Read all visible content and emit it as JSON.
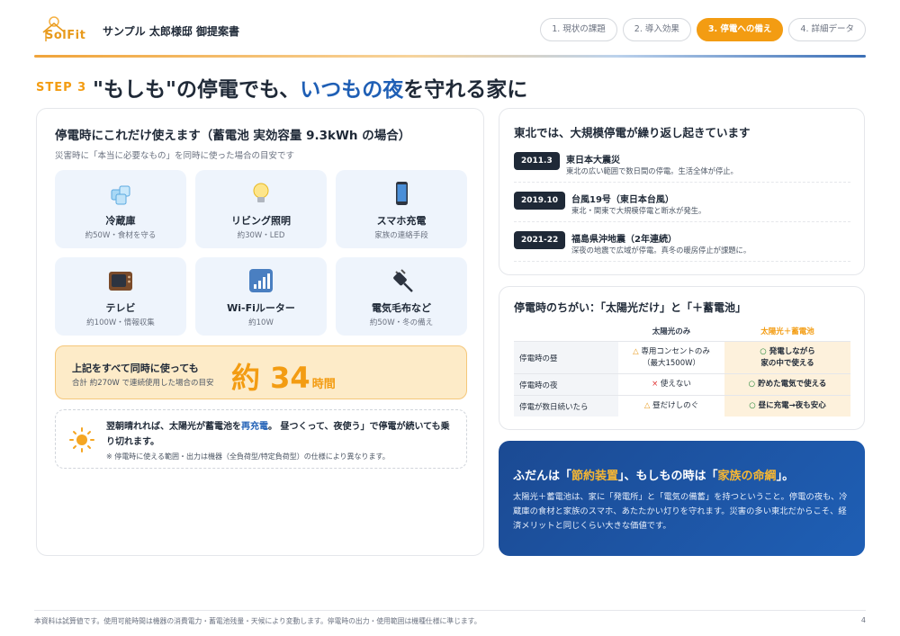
{
  "header": {
    "logo_text": "SolFit",
    "doc_title": "サンプル 太郎様邸 御提案書",
    "nav": [
      {
        "label": "1. 現状の課題",
        "active": false
      },
      {
        "label": "2. 導入効果",
        "active": false
      },
      {
        "label": "3. 停電への備え",
        "active": true
      },
      {
        "label": "4. 詳細データ",
        "active": false
      }
    ]
  },
  "headline": {
    "step": "STEP 3",
    "part1": "\"もしも\"の停電でも、",
    "highlight": "いつもの夜",
    "part2": "を守れる家に"
  },
  "left": {
    "title": "停電時にこれだけ使えます（蓄電池 実効容量 9.3kWh の場合）",
    "subtitle": "災害時に「本当に必要なもの」を同時に使った場合の目安です",
    "tiles": [
      {
        "icon": "ice-cube-icon",
        "label": "冷蔵庫",
        "note": "約50W・食材を守る"
      },
      {
        "icon": "light-bulb-icon",
        "label": "リビング照明",
        "note": "約30W・LED"
      },
      {
        "icon": "smartphone-icon",
        "label": "スマホ充電",
        "note": "家族の連絡手段"
      },
      {
        "icon": "tv-icon",
        "label": "テレビ",
        "note": "約100W・情報収集"
      },
      {
        "icon": "signal-bars-icon",
        "label": "Wi-Fiルーター",
        "note": "約10W"
      },
      {
        "icon": "plug-icon",
        "label": "電気毛布など",
        "note": "約50W・冬の備え"
      }
    ],
    "total": {
      "main": "上記をすべて同時に使っても",
      "note": "合計 約270W で連続使用した場合の目安",
      "value": "約 34",
      "unit": "時間"
    },
    "tip": {
      "text1": "翌朝晴れれば、太陽光が蓄電池を",
      "accent": "再充電",
      "text2": "。 昼つくって、夜使う」で停電が続いても乗り切れます。",
      "note": "※ 停電時に使える範囲・出力は機器（全負荷型/特定負荷型）の仕様により異なります。"
    }
  },
  "history": {
    "title": "東北では、大規模停電が繰り返し起きています",
    "events": [
      {
        "date": "2011.3",
        "title": "東日本大震災",
        "desc": "東北の広い範囲で数日間の停電。生活全体が停止。"
      },
      {
        "date": "2019.10",
        "title": "台風19号（東日本台風）",
        "desc": "東北・関東で大規模停電と断水が発生。"
      },
      {
        "date": "2021-22",
        "title": "福島県沖地震（2年連続）",
        "desc": "深夜の地震で広域が停電。真冬の暖房停止が課題に。"
      }
    ]
  },
  "compare": {
    "title": "停電時のちがい：「太陽光だけ」と「＋蓄電池」",
    "col1": "太陽光のみ",
    "col2": "太陽光＋蓄電池",
    "rows": [
      {
        "label": "停電時の昼",
        "mark1": "△",
        "v1a": "専用コンセントのみ",
        "v1b": "（最大1500W）",
        "mark2": "○",
        "v2a": "発電しながら",
        "v2b": "家の中で使える"
      },
      {
        "label": "停電時の夜",
        "mark1": "×",
        "v1a": "使えない",
        "v1b": "",
        "mark2": "○",
        "v2a": "貯めた電気で使える",
        "v2b": ""
      },
      {
        "label": "停電が数日続いたら",
        "mark1": "△",
        "v1a": "昼だけしのぐ",
        "v1b": "",
        "mark2": "○",
        "v2a": "昼に充電→夜も安心",
        "v2b": ""
      }
    ]
  },
  "message": {
    "t1": "ふだんは「",
    "g1": "節約装置",
    "t2": "」、もしもの時は「",
    "g2": "家族の命綱",
    "t3": "」。",
    "body": "太陽光＋蓄電池は、家に「発電所」と「電気の備蓄」を持つということ。停電の夜も、冷蔵庫の食材と家族のスマホ、あたたかい灯りを守れます。災害の多い東北だからこそ、経済メリットと同じくらい大きな価値です。"
  },
  "footer": {
    "note": "本資料は試算値です。使用可能時間は機器の消費電力・蓄電池残量・天候により変動します。停電時の出力・使用範囲は機種仕様に準じます。",
    "page": "4"
  },
  "colors": {
    "accent_orange": "#f39c12",
    "accent_blue": "#1f5fb5",
    "dark": "#1f2937"
  }
}
